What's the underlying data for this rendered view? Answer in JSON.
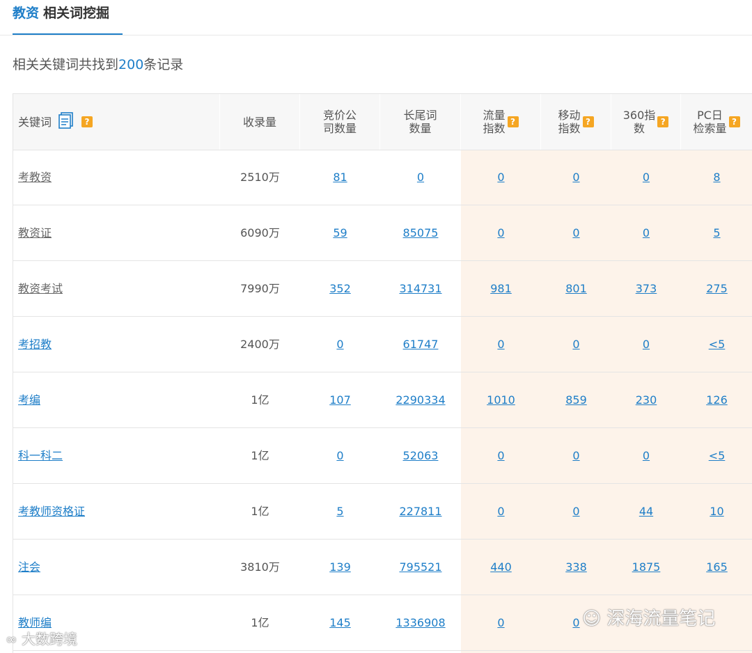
{
  "tab": {
    "keyword": "教资",
    "title": "相关词挖掘"
  },
  "summary": {
    "prefix": "相关关键词共找到",
    "count": "200",
    "suffix": "条记录"
  },
  "table": {
    "headers": [
      {
        "label": "关键词",
        "icon": "document-list-icon",
        "help": "?"
      },
      {
        "label": "收录量"
      },
      {
        "label": "竞价公\n司数量"
      },
      {
        "label": "长尾词\n数量"
      },
      {
        "label": "流量\n指数",
        "help": "?"
      },
      {
        "label": "移动\n指数",
        "help": "?"
      },
      {
        "label": "360指\n数",
        "help": "?"
      },
      {
        "label": "PC日\n检索量",
        "help": "?"
      }
    ],
    "rows": [
      {
        "keyword": "考教资",
        "kw_link": false,
        "indexed": "2510万",
        "bid": "81",
        "longtail": "0",
        "traffic": "0",
        "mobile": "0",
        "idx360": "0",
        "pc": "8"
      },
      {
        "keyword": "教资证",
        "kw_link": false,
        "indexed": "6090万",
        "bid": "59",
        "longtail": "85075",
        "traffic": "0",
        "mobile": "0",
        "idx360": "0",
        "pc": "5"
      },
      {
        "keyword": "教资考试",
        "kw_link": false,
        "indexed": "7990万",
        "bid": "352",
        "longtail": "314731",
        "traffic": "981",
        "mobile": "801",
        "idx360": "373",
        "pc": "275"
      },
      {
        "keyword": "考招教",
        "kw_link": true,
        "indexed": "2400万",
        "bid": "0",
        "longtail": "61747",
        "traffic": "0",
        "mobile": "0",
        "idx360": "0",
        "pc": "<5"
      },
      {
        "keyword": "考编",
        "kw_link": true,
        "indexed": "1亿",
        "bid": "107",
        "longtail": "2290334",
        "traffic": "1010",
        "mobile": "859",
        "idx360": "230",
        "pc": "126"
      },
      {
        "keyword": "科一科二",
        "kw_link": true,
        "indexed": "1亿",
        "bid": "0",
        "longtail": "52063",
        "traffic": "0",
        "mobile": "0",
        "idx360": "0",
        "pc": "<5"
      },
      {
        "keyword": "考教师资格证",
        "kw_link": true,
        "indexed": "1亿",
        "bid": "5",
        "longtail": "227811",
        "traffic": "0",
        "mobile": "0",
        "idx360": "44",
        "pc": "10"
      },
      {
        "keyword": "注会",
        "kw_link": true,
        "indexed": "3810万",
        "bid": "139",
        "longtail": "795521",
        "traffic": "440",
        "mobile": "338",
        "idx360": "1875",
        "pc": "165"
      },
      {
        "keyword": "教师编",
        "kw_link": true,
        "indexed": "1亿",
        "bid": "145",
        "longtail": "1336908",
        "traffic": "0",
        "mobile": "0",
        "idx360": "",
        "pc": ""
      }
    ]
  },
  "watermarks": {
    "left": "大数跨境",
    "right": "深海流量笔记"
  }
}
